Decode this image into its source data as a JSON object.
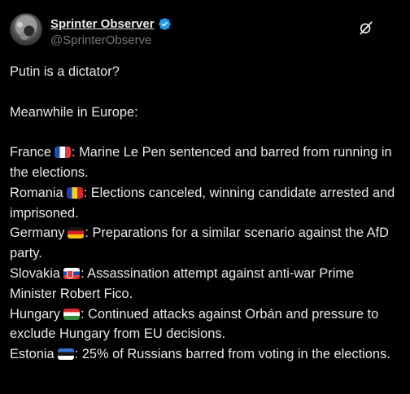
{
  "author": {
    "display_name": "Sprinter Observer",
    "handle": "@SprinterObserve",
    "avatar_icon": "avatar-image",
    "verified_icon": "verified-badge-icon",
    "verified_color": "#1d9bf0"
  },
  "actions": {
    "grok_icon": "grok-icon"
  },
  "post": {
    "line1": "Putin is a dictator?",
    "line2": "Meanwhile in Europe:",
    "items": [
      {
        "country": "France",
        "flag": "flag-france-icon",
        "text": ": Marine Le Pen sentenced and barred from running in the elections."
      },
      {
        "country": "Romania",
        "flag": "flag-romania-icon",
        "text": ": Elections canceled, winning candidate arrested and imprisoned."
      },
      {
        "country": "Germany",
        "flag": "flag-germany-icon",
        "text": ": Preparations for a similar scenario against the AfD party."
      },
      {
        "country": "Slovakia",
        "flag": "flag-slovakia-icon",
        "text": ": Assassination attempt against anti-war Prime Minister Robert Fico."
      },
      {
        "country": "Hungary",
        "flag": "flag-hungary-icon",
        "text": ": Continued attacks against Orbán and pressure to exclude Hungary from EU decisions."
      },
      {
        "country": "Estonia",
        "flag": "flag-estonia-icon",
        "text": ": 25% of Russians barred from voting in the elections."
      }
    ]
  },
  "colors": {
    "background": "#000000",
    "text": "#e7e9ea",
    "secondary": "#71767b"
  }
}
